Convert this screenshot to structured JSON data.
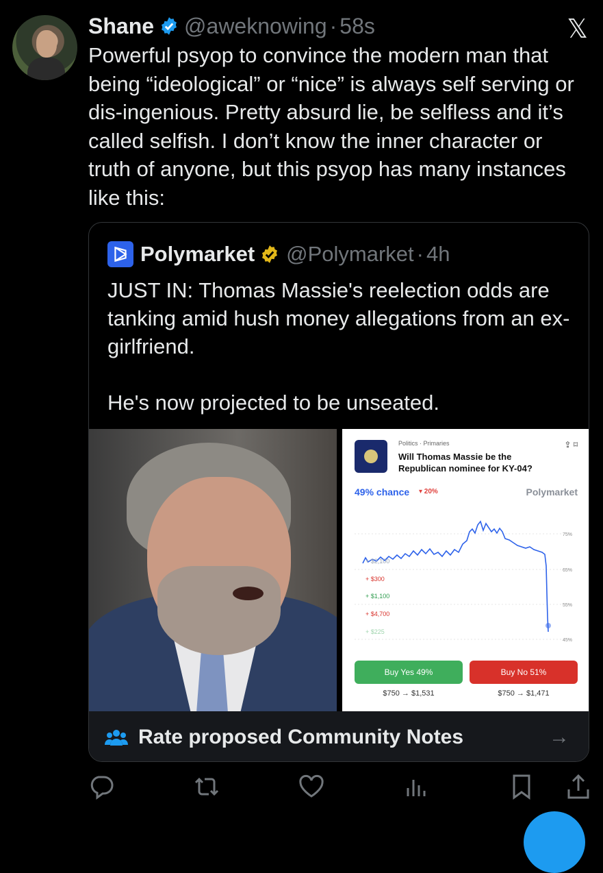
{
  "tweet": {
    "author_name": "Shane",
    "handle": "@aweknowing",
    "separator": "·",
    "time": "58s",
    "text": "Powerful psyop to convince the modern man that being “ideological” or “nice” is always self serving or dis-ingenious. Pretty absurd lie, be selfless and it’s called selfish. I don’t know the inner character or truth of anyone, but this psyop has many instances like this:",
    "x_logo": "𝕏"
  },
  "quote": {
    "author_name": "Polymarket",
    "handle": "@Polymarket",
    "separator": "·",
    "time": "4h",
    "text": "JUST IN: Thomas Massie's reelection odds are tanking amid hush money allegations from an ex-girlfriend.\n\nHe's now projected to be unseated."
  },
  "market_card": {
    "breadcrumb": "Politics · Primaries",
    "question": "Will Thomas Massie be the Republican nominee for KY-04?",
    "chance": "49% chance",
    "change": "▾ 20%",
    "brand": "Polymarket",
    "axis_labels": [
      "75%",
      "65%",
      "55%",
      "45%"
    ],
    "trade_feed": [
      {
        "text": "+ $2,100",
        "color": "#9aa6b8"
      },
      {
        "text": "+ $300",
        "color": "#d8312a"
      },
      {
        "text": "+ $1,100",
        "color": "#2e9c4e"
      },
      {
        "text": "+ $4,700",
        "color": "#d8312a"
      },
      {
        "text": "+ $225",
        "color": "#9fd4ad"
      }
    ],
    "buy_yes": "Buy Yes 49%",
    "buy_no": "Buy No 51%",
    "payout_yes": "$750 → $1,531",
    "payout_no": "$750 → $1,471",
    "line_color": "#2d62ea"
  },
  "community_notes": {
    "label": "Rate proposed Community Notes",
    "arrow": "→"
  },
  "actions": [
    "reply-icon",
    "retweet-icon",
    "like-icon",
    "views-icon",
    "bookmark-icon",
    "share-icon"
  ],
  "colors": {
    "background": "#000000",
    "text": "#e7e9ea",
    "muted": "#71767b",
    "accent": "#1d9bf0",
    "polymarket_blue": "#2d62ea"
  }
}
